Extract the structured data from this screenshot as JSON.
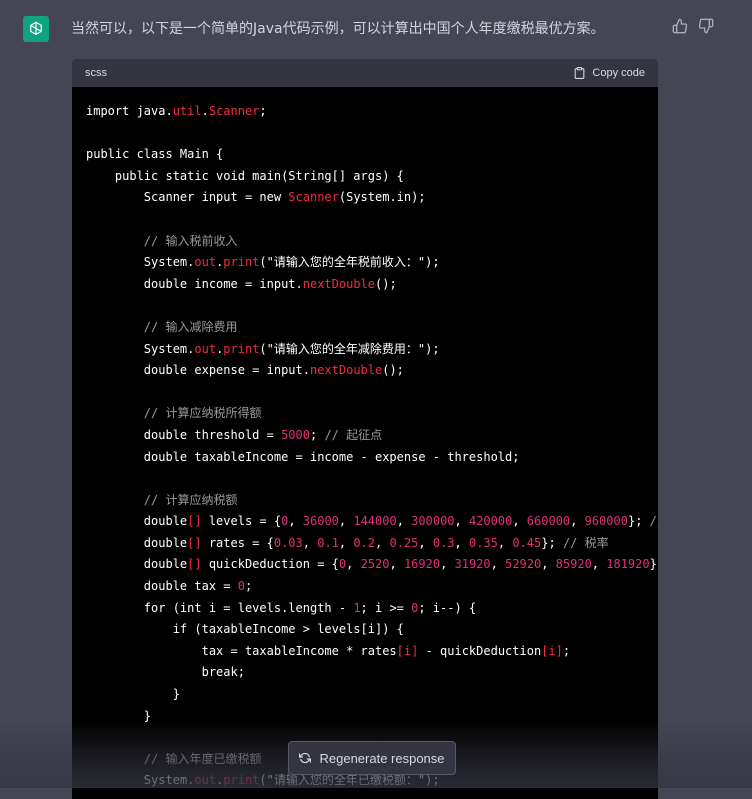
{
  "message": {
    "text": "当然可以，以下是一个简单的Java代码示例，可以计算出中国个人年度缴税最优方案。"
  },
  "code": {
    "language": "scss",
    "copy_label": "Copy code",
    "lines": [
      [
        [
          "t",
          "import java."
        ],
        [
          "tp",
          "util"
        ],
        [
          "t",
          "."
        ],
        [
          "tp",
          "Scanner"
        ],
        [
          "t",
          ";"
        ]
      ],
      [],
      [
        [
          "t",
          "public class Main {"
        ]
      ],
      [
        [
          "t",
          "    public static void main(String[] args) {"
        ]
      ],
      [
        [
          "t",
          "        Scanner input = new "
        ],
        [
          "tp",
          "Scanner"
        ],
        [
          "t",
          "(System.in);"
        ]
      ],
      [],
      [
        [
          "cm",
          "        // 输入税前收入"
        ]
      ],
      [
        [
          "t",
          "        System."
        ],
        [
          "tp",
          "out"
        ],
        [
          "t",
          "."
        ],
        [
          "tp",
          "print"
        ],
        [
          "str",
          "(\"请输入您的全年税前收入：\");"
        ]
      ],
      [
        [
          "t",
          "        double income = input."
        ],
        [
          "tp",
          "nextDouble"
        ],
        [
          "t",
          "();"
        ]
      ],
      [],
      [
        [
          "cm",
          "        // 输入减除费用"
        ]
      ],
      [
        [
          "t",
          "        System."
        ],
        [
          "tp",
          "out"
        ],
        [
          "t",
          "."
        ],
        [
          "tp",
          "print"
        ],
        [
          "str",
          "(\"请输入您的全年减除费用：\");"
        ]
      ],
      [
        [
          "t",
          "        double expense = input."
        ],
        [
          "tp",
          "nextDouble"
        ],
        [
          "t",
          "();"
        ]
      ],
      [],
      [
        [
          "cm",
          "        // 计算应纳税所得额"
        ]
      ],
      [
        [
          "t",
          "        double threshold = "
        ],
        [
          "num",
          "5000"
        ],
        [
          "t",
          "; "
        ],
        [
          "cm",
          "// 起征点"
        ]
      ],
      [
        [
          "t",
          "        double taxableIncome = income - expense - threshold;"
        ]
      ],
      [],
      [
        [
          "cm",
          "        // 计算应纳税额"
        ]
      ],
      [
        [
          "t",
          "        double"
        ],
        [
          "tp",
          "[]"
        ],
        [
          "t",
          " levels = {"
        ],
        [
          "num",
          "0"
        ],
        [
          "t",
          ", "
        ],
        [
          "num",
          "36000"
        ],
        [
          "t",
          ", "
        ],
        [
          "num",
          "144000"
        ],
        [
          "t",
          ", "
        ],
        [
          "num",
          "300000"
        ],
        [
          "t",
          ", "
        ],
        [
          "num",
          "420000"
        ],
        [
          "t",
          ", "
        ],
        [
          "num",
          "660000"
        ],
        [
          "t",
          ", "
        ],
        [
          "num",
          "960000"
        ],
        [
          "t",
          "}; "
        ],
        [
          "cm",
          "// 级"
        ]
      ],
      [
        [
          "t",
          "        double"
        ],
        [
          "tp",
          "[]"
        ],
        [
          "t",
          " rates = {"
        ],
        [
          "num",
          "0.03"
        ],
        [
          "t",
          ", "
        ],
        [
          "num",
          "0.1"
        ],
        [
          "t",
          ", "
        ],
        [
          "num",
          "0.2"
        ],
        [
          "t",
          ", "
        ],
        [
          "num",
          "0.25"
        ],
        [
          "t",
          ", "
        ],
        [
          "num",
          "0.3"
        ],
        [
          "t",
          ", "
        ],
        [
          "num",
          "0.35"
        ],
        [
          "t",
          ", "
        ],
        [
          "num",
          "0.45"
        ],
        [
          "t",
          "}; "
        ],
        [
          "cm",
          "// 税率"
        ]
      ],
      [
        [
          "t",
          "        double"
        ],
        [
          "tp",
          "[]"
        ],
        [
          "t",
          " quickDeduction = {"
        ],
        [
          "num",
          "0"
        ],
        [
          "t",
          ", "
        ],
        [
          "num",
          "2520"
        ],
        [
          "t",
          ", "
        ],
        [
          "num",
          "16920"
        ],
        [
          "t",
          ", "
        ],
        [
          "num",
          "31920"
        ],
        [
          "t",
          ", "
        ],
        [
          "num",
          "52920"
        ],
        [
          "t",
          ", "
        ],
        [
          "num",
          "85920"
        ],
        [
          "t",
          ", "
        ],
        [
          "num",
          "181920"
        ],
        [
          "t",
          "}; "
        ],
        [
          "cm",
          "//"
        ]
      ],
      [
        [
          "t",
          "        double tax = "
        ],
        [
          "num",
          "0"
        ],
        [
          "t",
          ";"
        ]
      ],
      [
        [
          "t",
          "        for (int i = levels.length - "
        ],
        [
          "num",
          "1"
        ],
        [
          "t",
          "; i >= "
        ],
        [
          "num",
          "0"
        ],
        [
          "t",
          "; i--) {"
        ]
      ],
      [
        [
          "t",
          "            if (taxableIncome > levels[i]) {"
        ]
      ],
      [
        [
          "t",
          "                tax = taxableIncome * rates"
        ],
        [
          "tp",
          "[i]"
        ],
        [
          "t",
          " - quickDeduction"
        ],
        [
          "tp",
          "[i]"
        ],
        [
          "t",
          ";"
        ]
      ],
      [
        [
          "t",
          "                break;"
        ]
      ],
      [
        [
          "t",
          "            }"
        ]
      ],
      [
        [
          "t",
          "        }"
        ]
      ],
      [],
      [
        [
          "cm",
          "        // 输入年度已缴税额"
        ]
      ],
      [
        [
          "t",
          "        System."
        ],
        [
          "tp",
          "out"
        ],
        [
          "t",
          "."
        ],
        [
          "tp",
          "print"
        ],
        [
          "str",
          "(\"请输入您的全年已缴税额：\");"
        ]
      ]
    ]
  },
  "regenerate": {
    "label": "Regenerate response"
  },
  "colors": {
    "background": "#444654",
    "code_bg": "#000000",
    "accent": "#10a37f",
    "type": "#f22c3d",
    "number": "#df3079",
    "comment": "#9a9a9a"
  },
  "icons": {
    "avatar": "openai-logo-icon",
    "thumb_up": "thumbs-up-icon",
    "thumb_down": "thumbs-down-icon",
    "copy": "clipboard-icon",
    "regen": "refresh-icon"
  }
}
